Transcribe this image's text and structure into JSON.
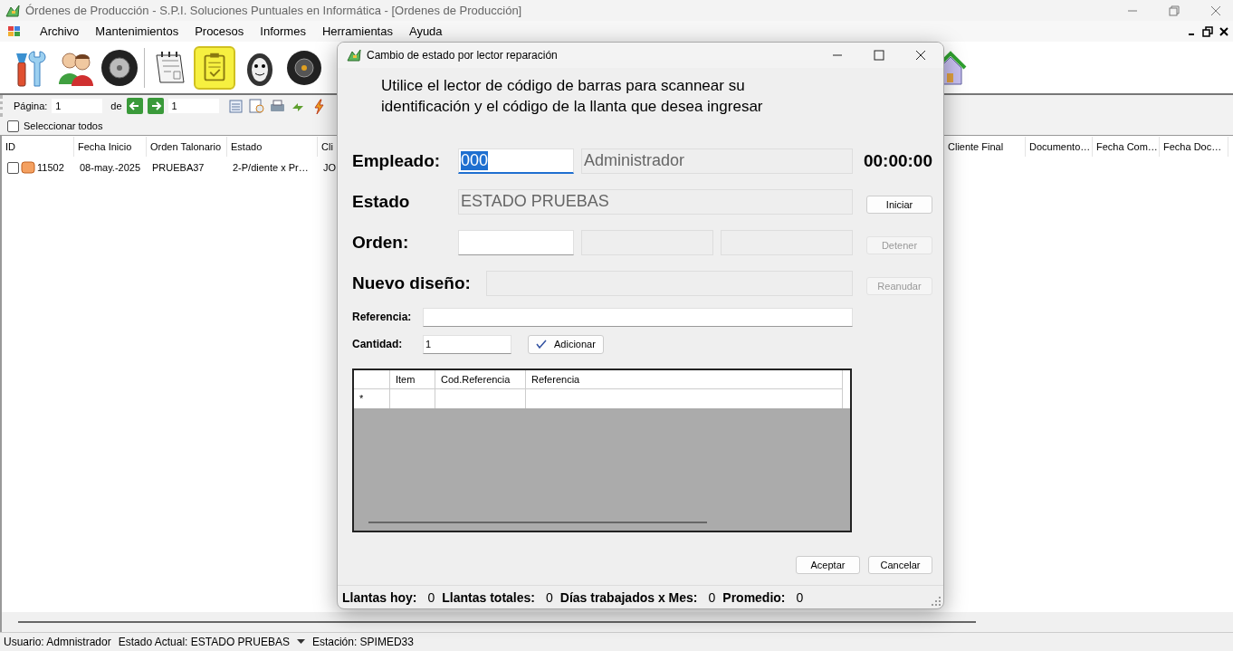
{
  "window": {
    "title": "Órdenes de Producción - S.P.I. Soluciones Puntuales en Informática - [Ordenes de Producción]"
  },
  "menu": [
    "Archivo",
    "Mantenimientos",
    "Procesos",
    "Informes",
    "Herramientas",
    "Ayuda"
  ],
  "toolbar": [
    {
      "kind": "tools",
      "selected": false
    },
    {
      "kind": "users",
      "selected": false
    },
    {
      "kind": "tire",
      "selected": false
    },
    {
      "kind": "notepad",
      "selected": false
    },
    {
      "kind": "clipboard",
      "selected": true
    },
    {
      "kind": "mascot",
      "selected": false
    },
    {
      "kind": "wheel",
      "selected": false
    },
    {
      "kind": "house",
      "selected": false
    }
  ],
  "pager": {
    "label": "Página:",
    "page": "1",
    "of": "de",
    "total": "1"
  },
  "select_all": {
    "label": "Seleccionar todos",
    "checked": false
  },
  "grid": {
    "columns": [
      "ID",
      "Fecha Inicio",
      "Orden Talonario",
      "Estado",
      "Cli",
      "Cliente Final",
      "Documento…",
      "Fecha Com…",
      "Fecha Doc…"
    ],
    "rows": [
      {
        "checked": false,
        "cells": [
          "11502",
          "08-may.-2025",
          "PRUEBA37",
          "2-P/diente x Pr…",
          "JO"
        ]
      }
    ]
  },
  "status_bar": {
    "user": "Usuario: Admnistrador",
    "state": "Estado Actual: ESTADO PRUEBAS",
    "station": "Estación: SPIMED33"
  },
  "dialog": {
    "title": "Cambio de estado por lector reparación",
    "instructions": "Utilice el lector de código de barras para scannear su identificación y el código de la llanta que desea ingresar",
    "empleado": {
      "label": "Empleado:",
      "code": "000",
      "name": "Administrador"
    },
    "timer": "00:00:00",
    "estado": {
      "label": "Estado",
      "value": "ESTADO PRUEBAS"
    },
    "orden": {
      "label": "Orden:"
    },
    "nuevo_diseno": {
      "label": "Nuevo diseño:"
    },
    "referencia": {
      "label": "Referencia:"
    },
    "cantidad": {
      "label": "Cantidad:",
      "value": "1"
    },
    "side_buttons": [
      {
        "label": "Iniciar",
        "disabled": false
      },
      {
        "label": "Detener",
        "disabled": true
      },
      {
        "label": "Reanudar",
        "disabled": true
      }
    ],
    "add_button": "Adicionar",
    "table": {
      "columns": [
        "Item",
        "Cod.Referencia",
        "Referencia"
      ],
      "new_row_marker": "*"
    },
    "buttons": [
      "Aceptar",
      "Cancelar"
    ],
    "stats": [
      {
        "label": "Llantas hoy:",
        "value": "0"
      },
      {
        "label": "Llantas totales:",
        "value": "0"
      },
      {
        "label": "Días trabajados x Mes:",
        "value": "0"
      },
      {
        "label": "Promedio:",
        "value": "0"
      }
    ]
  }
}
